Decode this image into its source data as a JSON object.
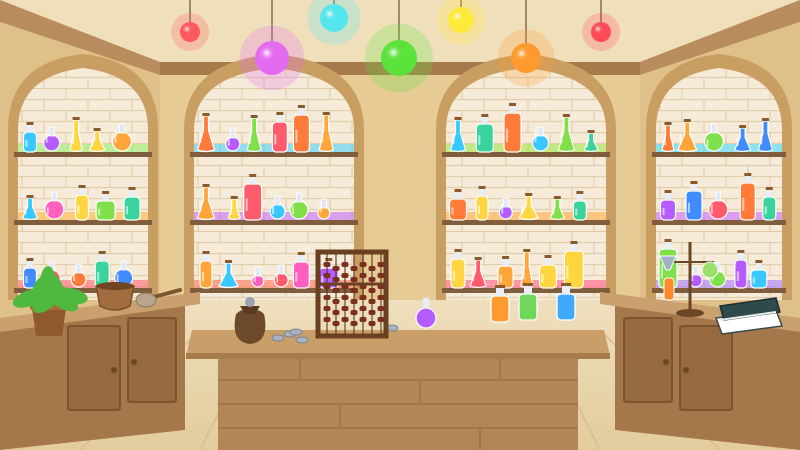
{
  "scene": {
    "name": "potion-shop",
    "palette": {
      "ceiling": "#efdcb6",
      "wall": "#e7cd98",
      "wall_dark": "#c79e63",
      "wood": "#b4875b",
      "wood_dark": "#8a6038",
      "counter_top": "#c49a68",
      "counter_front": "#a87a4f",
      "floor": "#e8d4ab",
      "brick": "#f3e8d4",
      "brick_line": "#dcc8a4",
      "shelf": "#8c6a48"
    },
    "lamps": [
      {
        "color": "#ff5a5f"
      },
      {
        "color": "#e36bf0"
      },
      {
        "color": "#54e6ee"
      },
      {
        "color": "#5be23b"
      },
      {
        "color": "#ffe93a"
      },
      {
        "color": "#ff9a2e"
      },
      {
        "color": "#ff4a5a"
      }
    ],
    "alcoves": [
      {
        "name": "far-left",
        "shelf_glow": [
          "#8cf06a",
          "#ffb238",
          "#ff5a6a"
        ]
      },
      {
        "name": "center-left",
        "shelf_glow": [
          "#3fd0ff",
          "#c060ff",
          "#ff6a50"
        ]
      },
      {
        "name": "center-right",
        "shelf_glow": [
          "#9be83c",
          "#ffa43a",
          "#ff5080"
        ]
      },
      {
        "name": "far-right",
        "shelf_glow": [
          "#38d8ff",
          "#c45cff",
          "#a070ff"
        ]
      }
    ],
    "props": [
      {
        "name": "potted-plant",
        "icon": "plant-icon"
      },
      {
        "name": "mortar-bowl",
        "icon": "mortar-icon"
      },
      {
        "name": "whisk-brush",
        "icon": "brush-icon"
      },
      {
        "name": "coin-pouch",
        "icon": "pouch-icon"
      },
      {
        "name": "abacus",
        "icon": "abacus-icon"
      },
      {
        "name": "funnel-stand",
        "icon": "alchemy-stand-icon"
      },
      {
        "name": "book-stack",
        "icon": "books-icon"
      }
    ]
  }
}
